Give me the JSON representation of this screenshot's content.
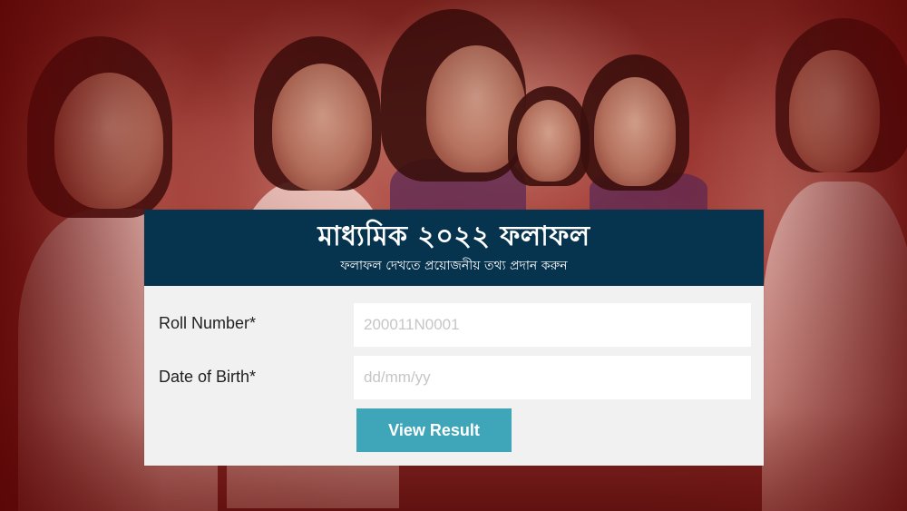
{
  "header": {
    "title": "মাধ্যমিক ২০২২ ফলাফল",
    "subtitle": "ফলাফল দেখতে প্রয়োজনীয় তথ্য প্রদান করুন"
  },
  "form": {
    "roll_label": "Roll Number*",
    "roll_placeholder": "200011N0001",
    "dob_label": "Date of Birth*",
    "dob_placeholder": "dd/mm/yy",
    "submit_label": "View Result"
  },
  "colors": {
    "header_bg": "#06334d",
    "button_bg": "#3fa6b9",
    "card_bg": "#f1f1f1",
    "backdrop_tint": "#8a2a25"
  }
}
